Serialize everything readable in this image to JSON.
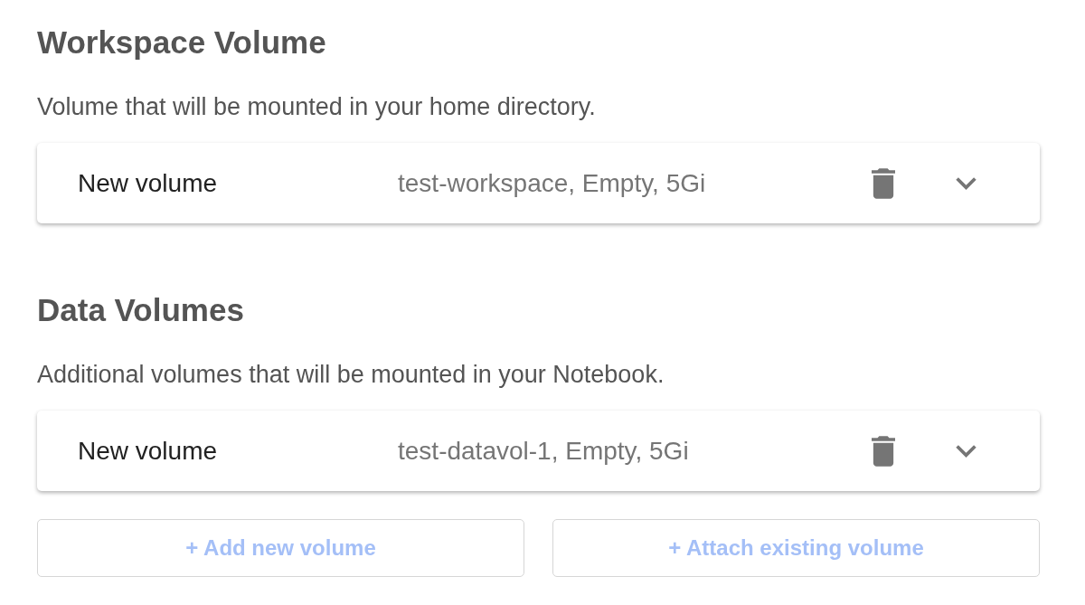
{
  "sections": [
    {
      "title": "Workspace Volume",
      "description": "Volume that will be mounted in your home directory.",
      "volumes": [
        {
          "name": "New volume",
          "summary": "test-workspace, Empty, 5Gi",
          "expanded": false
        }
      ]
    },
    {
      "title": "Data Volumes",
      "description": "Additional volumes that will be mounted in your Notebook.",
      "volumes": [
        {
          "name": "New volume",
          "summary": "test-datavol-1, Empty, 5Gi",
          "expanded": false
        }
      ],
      "actions": [
        {
          "label": "+ Add new volume"
        },
        {
          "label": "+ Attach existing volume"
        }
      ]
    }
  ]
}
